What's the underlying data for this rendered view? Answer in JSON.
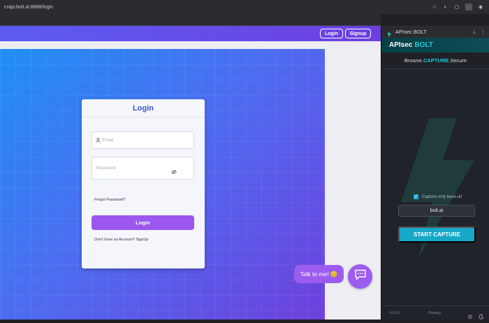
{
  "browser": {
    "url": "crapi.bolt.ai:8888/login"
  },
  "site": {
    "nav": {
      "login_label": "Login",
      "signup_label": "Signup"
    },
    "login_card": {
      "title": "Login",
      "email_placeholder": "Email",
      "password_placeholder": "Password",
      "forgot_link": "Forgot Password?",
      "login_button": "Login",
      "signup_text": "Don't have an Account? SignUp"
    },
    "chat": {
      "bubble_text": "Talk to me! 😊"
    }
  },
  "panel": {
    "title": "APIsec BOLT",
    "brand": {
      "part1": "APIsec",
      "part2": "BOLT"
    },
    "tagline": {
      "before": "Browse.",
      "highlight": "CAPTURE",
      "after": ".Secure"
    },
    "capture_only_base_url_label": "Capture only base-url",
    "capture_only_base_url_checked": true,
    "base_url_value": "bolt.ai",
    "start_button": "START CAPTURE",
    "footer": {
      "version": "v1.3.0",
      "privacy": "Privacy"
    }
  },
  "colors": {
    "accent_purple": "#9b57ee",
    "teal": "#22c8d8",
    "start_button": "#17a8c9"
  }
}
